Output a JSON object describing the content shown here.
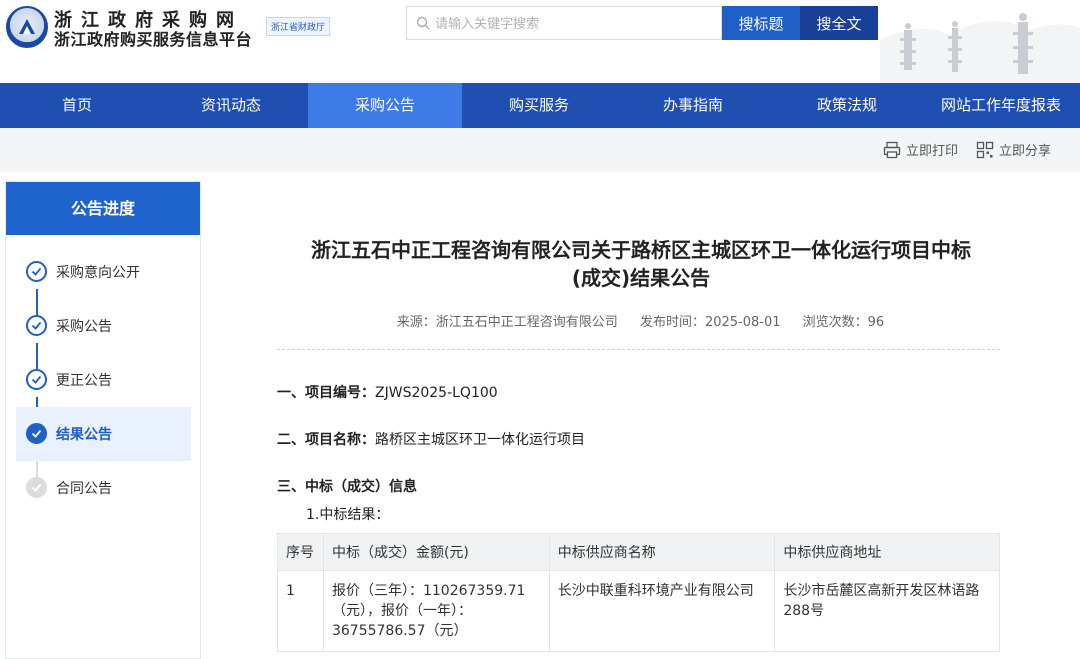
{
  "header": {
    "site_name": "浙江政府采购网",
    "site_sub": "浙江政府购买服务信息平台",
    "dept_badge": "浙江省财政厅"
  },
  "search": {
    "placeholder": "请输入关键字搜索",
    "btn_title": "搜标题",
    "btn_full": "搜全文"
  },
  "nav": {
    "items": [
      "首页",
      "资讯动态",
      "采购公告",
      "购买服务",
      "办事指南",
      "政策法规",
      "网站工作年度报表"
    ],
    "active_index": 2
  },
  "toolbar": {
    "print": "立即打印",
    "share": "立即分享"
  },
  "sidebar": {
    "title": "公告进度",
    "items": [
      {
        "label": "采购意向公开",
        "state": "done"
      },
      {
        "label": "采购公告",
        "state": "done"
      },
      {
        "label": "更正公告",
        "state": "done"
      },
      {
        "label": "结果公告",
        "state": "current"
      },
      {
        "label": "合同公告",
        "state": "pending"
      }
    ]
  },
  "article": {
    "title_line1": "浙江五石中正工程咨询有限公司关于路桥区主城区环卫一体化运行项目中标",
    "title_line2": "(成交)结果公告",
    "meta_source": "来源：浙江五石中正工程咨询有限公司",
    "meta_date": "发布时间：2025-08-01",
    "meta_views": "浏览次数：96",
    "sec1_label": "一、项目编号：",
    "sec1_value": "ZJWS2025-LQ100",
    "sec2_label": "二、项目名称：",
    "sec2_value": "路桥区主城区环卫一体化运行项目",
    "sec3_label": "三、中标（成交）信息",
    "sub1": "1.中标结果：",
    "table": {
      "headers": [
        "序号",
        "中标（成交）金额(元)",
        "中标供应商名称",
        "中标供应商地址"
      ],
      "rows": [
        [
          "1",
          "报价（三年）：110267359.71（元），报价（一年）：36755786.57（元）",
          "长沙中联重科环境产业有限公司",
          "长沙市岳麓区高新开发区林语路288号"
        ]
      ]
    }
  },
  "colors": {
    "nav_bg": "#1f4fb0",
    "nav_active": "#3d7ce6",
    "sidebar_title_bg": "#1f63cc",
    "accent": "#1f5fc6"
  }
}
